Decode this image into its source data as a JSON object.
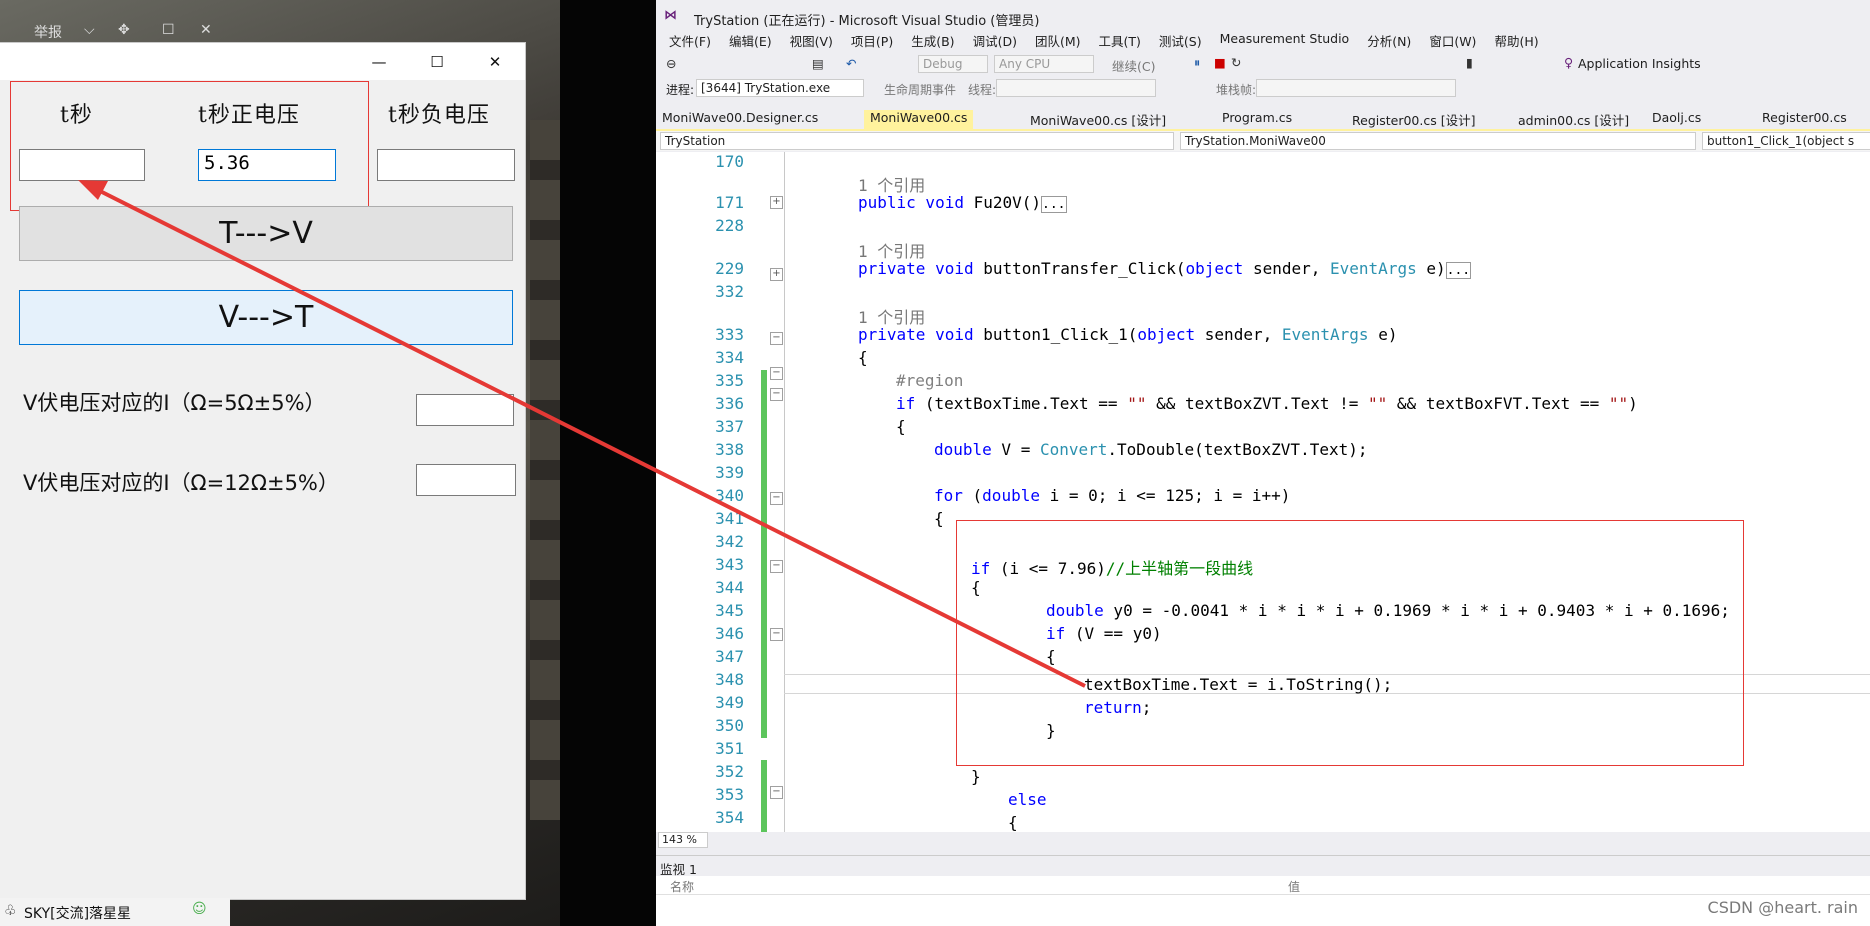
{
  "background_window": {
    "report": "举报"
  },
  "form": {
    "labels": {
      "t_sec": "t秒",
      "t_pos_v": "t秒正电压",
      "t_neg_v": "t秒负电压"
    },
    "inputs": {
      "time": "",
      "zvt": "5.36",
      "fvt": ""
    },
    "btn_t_to_v": "T--->V",
    "btn_v_to_t": "V--->T",
    "current_5": "V伏电压对应的I（Ω=5Ω±5%）",
    "current_12": "V伏电压对应的I（Ω=12Ω±5%）"
  },
  "taskbar": {
    "item": "SKY[交流]落星星"
  },
  "vs": {
    "title": "TryStation (正在运行) - Microsoft Visual Studio (管理员)",
    "menu": [
      "文件(F)",
      "编辑(E)",
      "视图(V)",
      "项目(P)",
      "生成(B)",
      "调试(D)",
      "团队(M)",
      "工具(T)",
      "测试(S)",
      "Measurement Studio",
      "分析(N)",
      "窗口(W)",
      "帮助(H)"
    ],
    "toolbar": {
      "config": "Debug",
      "platform": "Any CPU",
      "continue": "继续(C)",
      "app_insights": "Application Insights"
    },
    "toolbar2": {
      "process_label": "进程:",
      "process": "[3644] TryStation.exe",
      "lifecycle": "生命周期事件",
      "thread_label": "线程:",
      "stack_label": "堆栈帧:"
    },
    "tabs": [
      "MoniWave00.Designer.cs",
      "MoniWave00.cs",
      "MoniWave00.cs [设计]",
      "Program.cs",
      "Register00.cs [设计]",
      "admin00.cs [设计]",
      "Daolj.cs",
      "Register00.cs"
    ],
    "nav": {
      "project": "TryStation",
      "class": "TryStation.MoniWave00",
      "member": "button1_Click_1(object s"
    },
    "lines": [
      "170",
      "171",
      "228",
      "229",
      "332",
      "333",
      "334",
      "335",
      "336",
      "337",
      "338",
      "339",
      "340",
      "341",
      "342",
      "343",
      "344",
      "345",
      "346",
      "347",
      "348",
      "349",
      "350",
      "351",
      "352",
      "353",
      "354"
    ],
    "refs": "1 个引用",
    "zoom": "143 %",
    "watch_title": "监视 1",
    "watch_cols": {
      "name": "名称",
      "value": "值"
    }
  },
  "watermark": "CSDN @heart. rain",
  "colors": {
    "highlight_box": "#e53935",
    "arrow": "#e53935",
    "active_tab": "#fff29d"
  }
}
